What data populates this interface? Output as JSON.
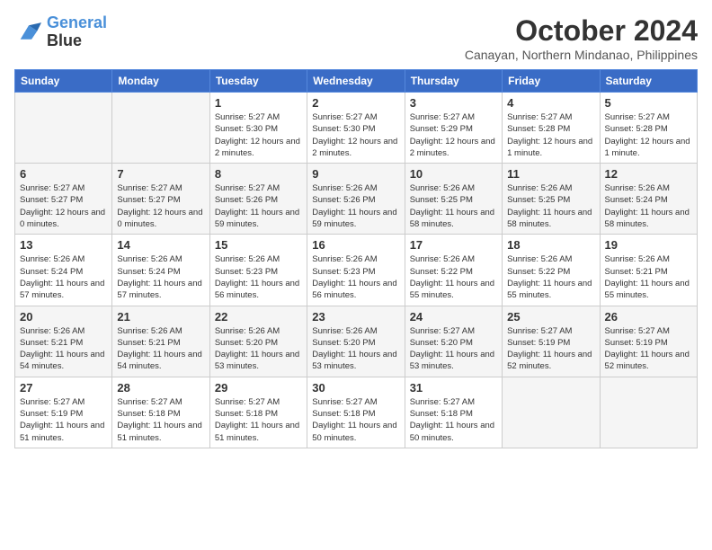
{
  "header": {
    "logo_line1": "General",
    "logo_line2": "Blue",
    "month": "October 2024",
    "location": "Canayan, Northern Mindanao, Philippines"
  },
  "weekdays": [
    "Sunday",
    "Monday",
    "Tuesday",
    "Wednesday",
    "Thursday",
    "Friday",
    "Saturday"
  ],
  "weeks": [
    [
      {
        "day": "",
        "info": ""
      },
      {
        "day": "",
        "info": ""
      },
      {
        "day": "1",
        "info": "Sunrise: 5:27 AM\nSunset: 5:30 PM\nDaylight: 12 hours and 2 minutes."
      },
      {
        "day": "2",
        "info": "Sunrise: 5:27 AM\nSunset: 5:30 PM\nDaylight: 12 hours and 2 minutes."
      },
      {
        "day": "3",
        "info": "Sunrise: 5:27 AM\nSunset: 5:29 PM\nDaylight: 12 hours and 2 minutes."
      },
      {
        "day": "4",
        "info": "Sunrise: 5:27 AM\nSunset: 5:28 PM\nDaylight: 12 hours and 1 minute."
      },
      {
        "day": "5",
        "info": "Sunrise: 5:27 AM\nSunset: 5:28 PM\nDaylight: 12 hours and 1 minute."
      }
    ],
    [
      {
        "day": "6",
        "info": "Sunrise: 5:27 AM\nSunset: 5:27 PM\nDaylight: 12 hours and 0 minutes."
      },
      {
        "day": "7",
        "info": "Sunrise: 5:27 AM\nSunset: 5:27 PM\nDaylight: 12 hours and 0 minutes."
      },
      {
        "day": "8",
        "info": "Sunrise: 5:27 AM\nSunset: 5:26 PM\nDaylight: 11 hours and 59 minutes."
      },
      {
        "day": "9",
        "info": "Sunrise: 5:26 AM\nSunset: 5:26 PM\nDaylight: 11 hours and 59 minutes."
      },
      {
        "day": "10",
        "info": "Sunrise: 5:26 AM\nSunset: 5:25 PM\nDaylight: 11 hours and 58 minutes."
      },
      {
        "day": "11",
        "info": "Sunrise: 5:26 AM\nSunset: 5:25 PM\nDaylight: 11 hours and 58 minutes."
      },
      {
        "day": "12",
        "info": "Sunrise: 5:26 AM\nSunset: 5:24 PM\nDaylight: 11 hours and 58 minutes."
      }
    ],
    [
      {
        "day": "13",
        "info": "Sunrise: 5:26 AM\nSunset: 5:24 PM\nDaylight: 11 hours and 57 minutes."
      },
      {
        "day": "14",
        "info": "Sunrise: 5:26 AM\nSunset: 5:24 PM\nDaylight: 11 hours and 57 minutes."
      },
      {
        "day": "15",
        "info": "Sunrise: 5:26 AM\nSunset: 5:23 PM\nDaylight: 11 hours and 56 minutes."
      },
      {
        "day": "16",
        "info": "Sunrise: 5:26 AM\nSunset: 5:23 PM\nDaylight: 11 hours and 56 minutes."
      },
      {
        "day": "17",
        "info": "Sunrise: 5:26 AM\nSunset: 5:22 PM\nDaylight: 11 hours and 55 minutes."
      },
      {
        "day": "18",
        "info": "Sunrise: 5:26 AM\nSunset: 5:22 PM\nDaylight: 11 hours and 55 minutes."
      },
      {
        "day": "19",
        "info": "Sunrise: 5:26 AM\nSunset: 5:21 PM\nDaylight: 11 hours and 55 minutes."
      }
    ],
    [
      {
        "day": "20",
        "info": "Sunrise: 5:26 AM\nSunset: 5:21 PM\nDaylight: 11 hours and 54 minutes."
      },
      {
        "day": "21",
        "info": "Sunrise: 5:26 AM\nSunset: 5:21 PM\nDaylight: 11 hours and 54 minutes."
      },
      {
        "day": "22",
        "info": "Sunrise: 5:26 AM\nSunset: 5:20 PM\nDaylight: 11 hours and 53 minutes."
      },
      {
        "day": "23",
        "info": "Sunrise: 5:26 AM\nSunset: 5:20 PM\nDaylight: 11 hours and 53 minutes."
      },
      {
        "day": "24",
        "info": "Sunrise: 5:27 AM\nSunset: 5:20 PM\nDaylight: 11 hours and 53 minutes."
      },
      {
        "day": "25",
        "info": "Sunrise: 5:27 AM\nSunset: 5:19 PM\nDaylight: 11 hours and 52 minutes."
      },
      {
        "day": "26",
        "info": "Sunrise: 5:27 AM\nSunset: 5:19 PM\nDaylight: 11 hours and 52 minutes."
      }
    ],
    [
      {
        "day": "27",
        "info": "Sunrise: 5:27 AM\nSunset: 5:19 PM\nDaylight: 11 hours and 51 minutes."
      },
      {
        "day": "28",
        "info": "Sunrise: 5:27 AM\nSunset: 5:18 PM\nDaylight: 11 hours and 51 minutes."
      },
      {
        "day": "29",
        "info": "Sunrise: 5:27 AM\nSunset: 5:18 PM\nDaylight: 11 hours and 51 minutes."
      },
      {
        "day": "30",
        "info": "Sunrise: 5:27 AM\nSunset: 5:18 PM\nDaylight: 11 hours and 50 minutes."
      },
      {
        "day": "31",
        "info": "Sunrise: 5:27 AM\nSunset: 5:18 PM\nDaylight: 11 hours and 50 minutes."
      },
      {
        "day": "",
        "info": ""
      },
      {
        "day": "",
        "info": ""
      }
    ]
  ]
}
